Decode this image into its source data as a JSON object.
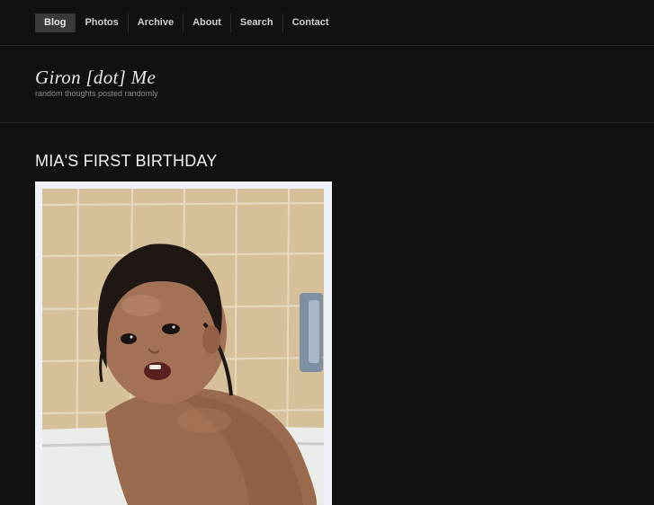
{
  "nav": {
    "items": [
      {
        "label": "Blog",
        "active": true
      },
      {
        "label": "Photos",
        "active": false
      },
      {
        "label": "Archive",
        "active": false
      },
      {
        "label": "About",
        "active": false
      },
      {
        "label": "Search",
        "active": false
      },
      {
        "label": "Contact",
        "active": false
      }
    ]
  },
  "header": {
    "title": "Giron [dot] Me",
    "tagline": "random thoughts posted randomly"
  },
  "post": {
    "title": "MIA'S FIRST BIRTHDAY",
    "photo_icon": "baby-photo"
  },
  "colors": {
    "background": "#111112",
    "nav_active_bg": "#3a3a3b",
    "photo_border": "#eef0f8"
  }
}
